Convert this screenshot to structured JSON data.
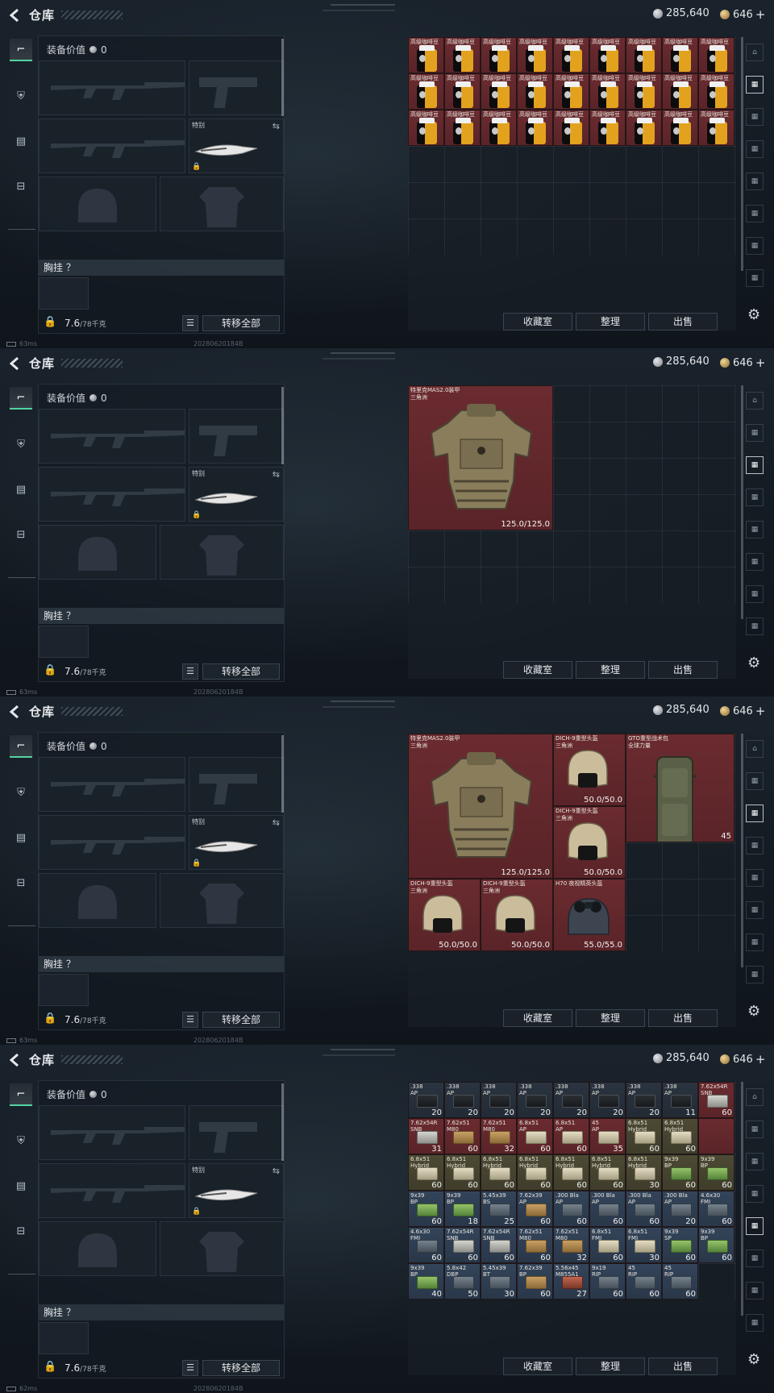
{
  "header": {
    "title": "仓库",
    "currency_silver": "285,640",
    "currency_gold": "646",
    "plus_label": "+"
  },
  "loadout": {
    "equip_value_label": "装备价值",
    "equip_value": "0",
    "melee_label": "特别",
    "chest_rig_label": "胸挂 ？",
    "weight_value": "7.6",
    "weight_max": "/78千克",
    "list_icon_label": "☰",
    "transfer_all_label": "转移全部"
  },
  "status": {
    "ping_values": [
      "63ms",
      "63ms",
      "63ms",
      "62ms"
    ],
    "build_id": "20280620184B"
  },
  "actions": {
    "collection_label": "收藏室",
    "organize_label": "整理",
    "sell_label": "出售"
  },
  "rail_icons": [
    "gate-icon",
    "stash-tab-1-icon",
    "stash-tab-2-icon",
    "stash-tab-3-icon",
    "stash-tab-4-icon",
    "stash-tab-5-icon",
    "stash-tab-6-icon",
    "stash-tab-7-icon"
  ],
  "panels": [
    {
      "active_tab": 1,
      "coffee": {
        "name": "高级咖啡豆",
        "count": 27
      }
    },
    {
      "active_tab": 2,
      "items": [
        {
          "name": "特里克MAS2.0装甲",
          "sub": "三角洲",
          "durability": "125.0/125.0"
        }
      ]
    },
    {
      "active_tab": 2,
      "items": [
        {
          "name": "特里克MAS2.0装甲",
          "sub": "三角洲",
          "durability": "125.0/125.0"
        },
        {
          "name": "DICH-9重型头盔",
          "sub": "三角洲",
          "durability": "50.0/50.0"
        },
        {
          "name": "GTO重型战术包",
          "sub": "全球力量",
          "durability": "45"
        },
        {
          "name": "DICH-9重型头盔",
          "sub": "三角洲",
          "durability": "50.0/50.0"
        },
        {
          "name": "DICH-9重型头盔",
          "sub": "三角洲",
          "durability": "50.0/50.0"
        },
        {
          "name": "DICH-9重型头盔",
          "sub": "三角洲",
          "durability": "50.0/50.0"
        },
        {
          "name": "H70 夜视精英头盔",
          "sub": "",
          "durability": "55.0/55.0"
        }
      ]
    },
    {
      "active_tab": 4,
      "ammo": [
        [
          {
            "n": ".338",
            "s": "AP",
            "q": "20",
            "c": "dark",
            "b": ""
          },
          {
            "n": ".338",
            "s": "AP",
            "q": "20",
            "c": "dark",
            "b": ""
          },
          {
            "n": ".338",
            "s": "AP",
            "q": "20",
            "c": "dark",
            "b": ""
          },
          {
            "n": ".338",
            "s": "AP",
            "q": "20",
            "c": "dark",
            "b": ""
          },
          {
            "n": ".338",
            "s": "AP",
            "q": "20",
            "c": "dark",
            "b": ""
          },
          {
            "n": ".338",
            "s": "AP",
            "q": "20",
            "c": "dark",
            "b": ""
          },
          {
            "n": ".338",
            "s": "AP",
            "q": "20",
            "c": "dark",
            "b": ""
          },
          {
            "n": ".338",
            "s": "AP",
            "q": "11",
            "c": "dark",
            "b": ""
          },
          {
            "n": "7.62x54R",
            "s": "SNB",
            "q": "60",
            "c": "red",
            "b": "grey"
          }
        ],
        [
          {
            "n": "7.62x54R",
            "s": "SNB",
            "q": "31",
            "c": "red",
            "b": "grey"
          },
          {
            "n": "7.62x51",
            "s": "M80",
            "q": "60",
            "c": "red",
            "b": "tan"
          },
          {
            "n": "7.62x51",
            "s": "M80",
            "q": "32",
            "c": "red",
            "b": "tan"
          },
          {
            "n": "6.8x51",
            "s": "AP",
            "q": "60",
            "c": "red",
            "b": "cream"
          },
          {
            "n": "6.8x51",
            "s": "AP",
            "q": "60",
            "c": "red",
            "b": "cream"
          },
          {
            "n": "45",
            "s": "AP",
            "q": "35",
            "c": "red",
            "b": "cream"
          },
          {
            "n": "6.8x51",
            "s": "Hybrid",
            "q": "60",
            "c": "olive",
            "b": "cream"
          },
          {
            "n": "6.8x51",
            "s": "Hybrid",
            "q": "60",
            "c": "olive",
            "b": "cream"
          },
          {
            "n": "",
            "s": "",
            "q": "",
            "c": "red",
            "b": ""
          }
        ],
        [
          {
            "n": "6.8x51",
            "s": "Hybrid",
            "q": "60",
            "c": "olive",
            "b": "cream"
          },
          {
            "n": "6.8x51",
            "s": "Hybrid",
            "q": "60",
            "c": "olive",
            "b": "cream"
          },
          {
            "n": "6.8x51",
            "s": "Hybrid",
            "q": "60",
            "c": "olive",
            "b": "cream"
          },
          {
            "n": "6.8x51",
            "s": "Hybrid",
            "q": "60",
            "c": "olive",
            "b": "cream"
          },
          {
            "n": "6.8x51",
            "s": "Hybrid",
            "q": "60",
            "c": "olive",
            "b": "cream"
          },
          {
            "n": "6.8x51",
            "s": "Hybrid",
            "q": "60",
            "c": "olive",
            "b": "cream"
          },
          {
            "n": "6.8x51",
            "s": "Hybrid",
            "q": "30",
            "c": "olive",
            "b": "cream"
          },
          {
            "n": "9x39",
            "s": "BP",
            "q": "60",
            "c": "olive",
            "b": "green"
          },
          {
            "n": "9x39",
            "s": "BP",
            "q": "60",
            "c": "olive",
            "b": "green"
          }
        ],
        [
          {
            "n": "9x39",
            "s": "BP",
            "q": "60",
            "c": "blue",
            "b": "green"
          },
          {
            "n": "9x39",
            "s": "BP",
            "q": "18",
            "c": "blue",
            "b": "green"
          },
          {
            "n": "5.45x39",
            "s": "BS",
            "q": "25",
            "c": "blue",
            "b": "slate"
          },
          {
            "n": "7.62x39",
            "s": "AP",
            "q": "60",
            "c": "blue",
            "b": "tan"
          },
          {
            "n": ".300 Bla",
            "s": "AP",
            "q": "60",
            "c": "blue",
            "b": "slate"
          },
          {
            "n": ".300 Bla",
            "s": "AP",
            "q": "60",
            "c": "blue",
            "b": "slate"
          },
          {
            "n": ".300 Bla",
            "s": "AP",
            "q": "60",
            "c": "blue",
            "b": "slate"
          },
          {
            "n": ".300 Bla",
            "s": "AP",
            "q": "20",
            "c": "blue",
            "b": "slate"
          },
          {
            "n": "4.6x30",
            "s": "FMJ",
            "q": "60",
            "c": "blue",
            "b": "slate"
          }
        ],
        [
          {
            "n": "4.6x30",
            "s": "FMJ",
            "q": "60",
            "c": "blue",
            "b": "slate"
          },
          {
            "n": "7.62x54R",
            "s": "SNB",
            "q": "60",
            "c": "blue",
            "b": "grey"
          },
          {
            "n": "7.62x54R",
            "s": "SNB",
            "q": "60",
            "c": "blue",
            "b": "grey"
          },
          {
            "n": "7.62x51",
            "s": "M80",
            "q": "60",
            "c": "blue",
            "b": "tan"
          },
          {
            "n": "7.62x51",
            "s": "M80",
            "q": "32",
            "c": "blue",
            "b": "tan"
          },
          {
            "n": "6.8x51",
            "s": "FMJ",
            "q": "60",
            "c": "blue",
            "b": "cream"
          },
          {
            "n": "6.8x51",
            "s": "FMJ",
            "q": "30",
            "c": "blue",
            "b": "cream"
          },
          {
            "n": "9x39",
            "s": "SP",
            "q": "60",
            "c": "blue",
            "b": "green"
          },
          {
            "n": "9x39",
            "s": "BP",
            "q": "60",
            "c": "blue",
            "b": "green"
          }
        ],
        [
          {
            "n": "9x39",
            "s": "BP",
            "q": "40",
            "c": "blue",
            "b": "green"
          },
          {
            "n": "5.8x42",
            "s": "DBP",
            "q": "50",
            "c": "blue",
            "b": "slate"
          },
          {
            "n": "5.45x39",
            "s": "BT",
            "q": "30",
            "c": "blue",
            "b": "slate"
          },
          {
            "n": "7.62x39",
            "s": "BP",
            "q": "60",
            "c": "blue",
            "b": "tan"
          },
          {
            "n": "5.56x45",
            "s": "M855A1",
            "q": "27",
            "c": "blue",
            "b": "red"
          },
          {
            "n": "9x19",
            "s": "RIP",
            "q": "60",
            "c": "blue",
            "b": "slate"
          },
          {
            "n": "45",
            "s": "RIP",
            "q": "60",
            "c": "blue",
            "b": "slate"
          },
          {
            "n": "45",
            "s": "RIP",
            "q": "60",
            "c": "blue",
            "b": "slate"
          },
          {
            "n": "",
            "s": "",
            "q": "",
            "c": "none",
            "b": ""
          }
        ]
      ]
    }
  ]
}
